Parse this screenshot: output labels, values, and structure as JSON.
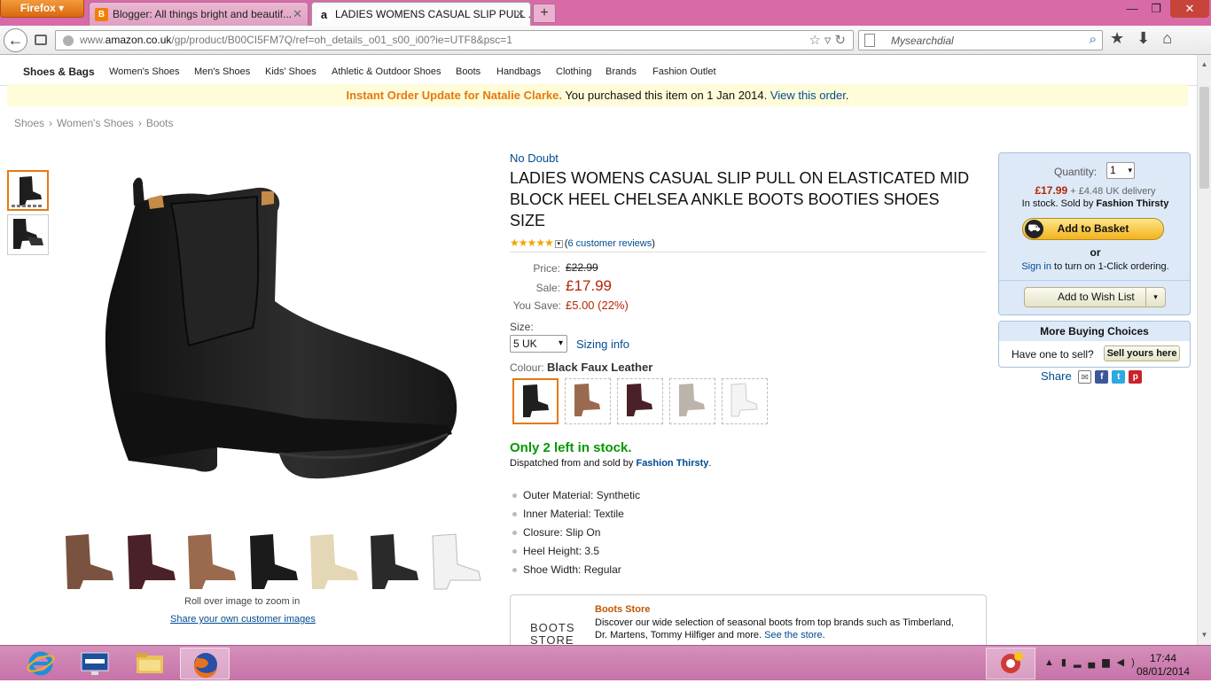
{
  "browser": {
    "menu_button": "Firefox",
    "tabs": [
      {
        "title": "Blogger: All things bright and beautif..."
      },
      {
        "title": "LADIES WOMENS CASUAL SLIP PULL ..."
      }
    ],
    "url_prefix": "www.",
    "url_domain": "amazon.co.uk",
    "url_path": "/gp/product/B00CI5FM7Q/ref=oh_details_o01_s00_i00?ie=UTF8&psc=1",
    "search_placeholder": "Mysearchdial"
  },
  "subnav": {
    "brand": "Shoes & Bags",
    "items": [
      "Women's Shoes",
      "Men's Shoes",
      "Kids' Shoes",
      "Athletic & Outdoor Shoes",
      "Boots",
      "Handbags",
      "Clothing",
      "Brands",
      "Fashion Outlet"
    ]
  },
  "order_update": {
    "highlight": "Instant Order Update for Natalie Clarke.",
    "text": " You purchased this item on 1 Jan 2014. ",
    "link": "View this order",
    "end": "."
  },
  "breadcrumb": [
    "Shoes",
    "Women's Shoes",
    "Boots"
  ],
  "gallery": {
    "zoom_note": "Roll over image to zoom in",
    "share_link": "Share your own customer images",
    "swatch_colors": [
      "#7a5340",
      "#4a2128",
      "#9a6a4e",
      "#1b1b1b",
      "#e4d7b6",
      "#2a2a2a",
      "#f2f2f2"
    ]
  },
  "product": {
    "brand": "No Doubt",
    "title": "LADIES WOMENS CASUAL SLIP PULL ON ELASTICATED MID BLOCK HEEL CHELSEA ANKLE BOOTS BOOTIES SHOES SIZE",
    "stars": "★★★★★",
    "reviews_link": "6 customer reviews",
    "price_label": "Price:",
    "price": "£22.99",
    "sale_label": "Sale:",
    "sale": "£17.99",
    "save_label": "You Save:",
    "save": "£5.00 (22%)",
    "size_label": "Size:",
    "size_value": "5 UK",
    "sizing_info": "Sizing info",
    "colour_label": "Colour:",
    "colour_value": "Black Faux Leather",
    "colour_swatches": [
      "#1f1f1f",
      "#9a6a4e",
      "#4a2128",
      "#bcb3ab",
      "#f4f4f4"
    ],
    "stock": "Only 2 left in stock.",
    "dispatch_text": "Dispatched from and sold by ",
    "dispatch_seller": "Fashion Thirsty",
    "dispatch_end": ".",
    "features": [
      {
        "label": "Outer Material:",
        "value": "Synthetic"
      },
      {
        "label": "Inner Material:",
        "value": "Textile"
      },
      {
        "label": "Closure:",
        "value": "Slip On"
      },
      {
        "label": "Heel Height:",
        "value": "3.5"
      },
      {
        "label": "Shoe Width:",
        "value": "Regular"
      }
    ]
  },
  "store": {
    "logo_line1": "BOOTS",
    "logo_line2": "STORE",
    "title": "Boots Store",
    "desc": "Discover our wide selection of seasonal boots from top brands such as Timberland, Dr. Martens, Tommy Hilfiger and more. ",
    "link": "See the store",
    "end": "."
  },
  "buybox": {
    "qty_label": "Quantity:",
    "qty_value": "1",
    "price": "£17.99",
    "delivery": "+ £4.48 UK delivery",
    "stock_text": "In stock. Sold by ",
    "seller": "Fashion Thirsty",
    "add_basket": "Add to Basket",
    "or": "or",
    "signin": "Sign in",
    "signin_rest": " to turn on 1-Click ordering.",
    "wishlist": "Add to Wish List"
  },
  "more_buying": {
    "title": "More Buying Choices",
    "text": "Have one to sell?",
    "button": "Sell yours here"
  },
  "share": {
    "label": "Share"
  },
  "taskbar": {
    "time": "17:44",
    "date": "08/01/2014"
  }
}
